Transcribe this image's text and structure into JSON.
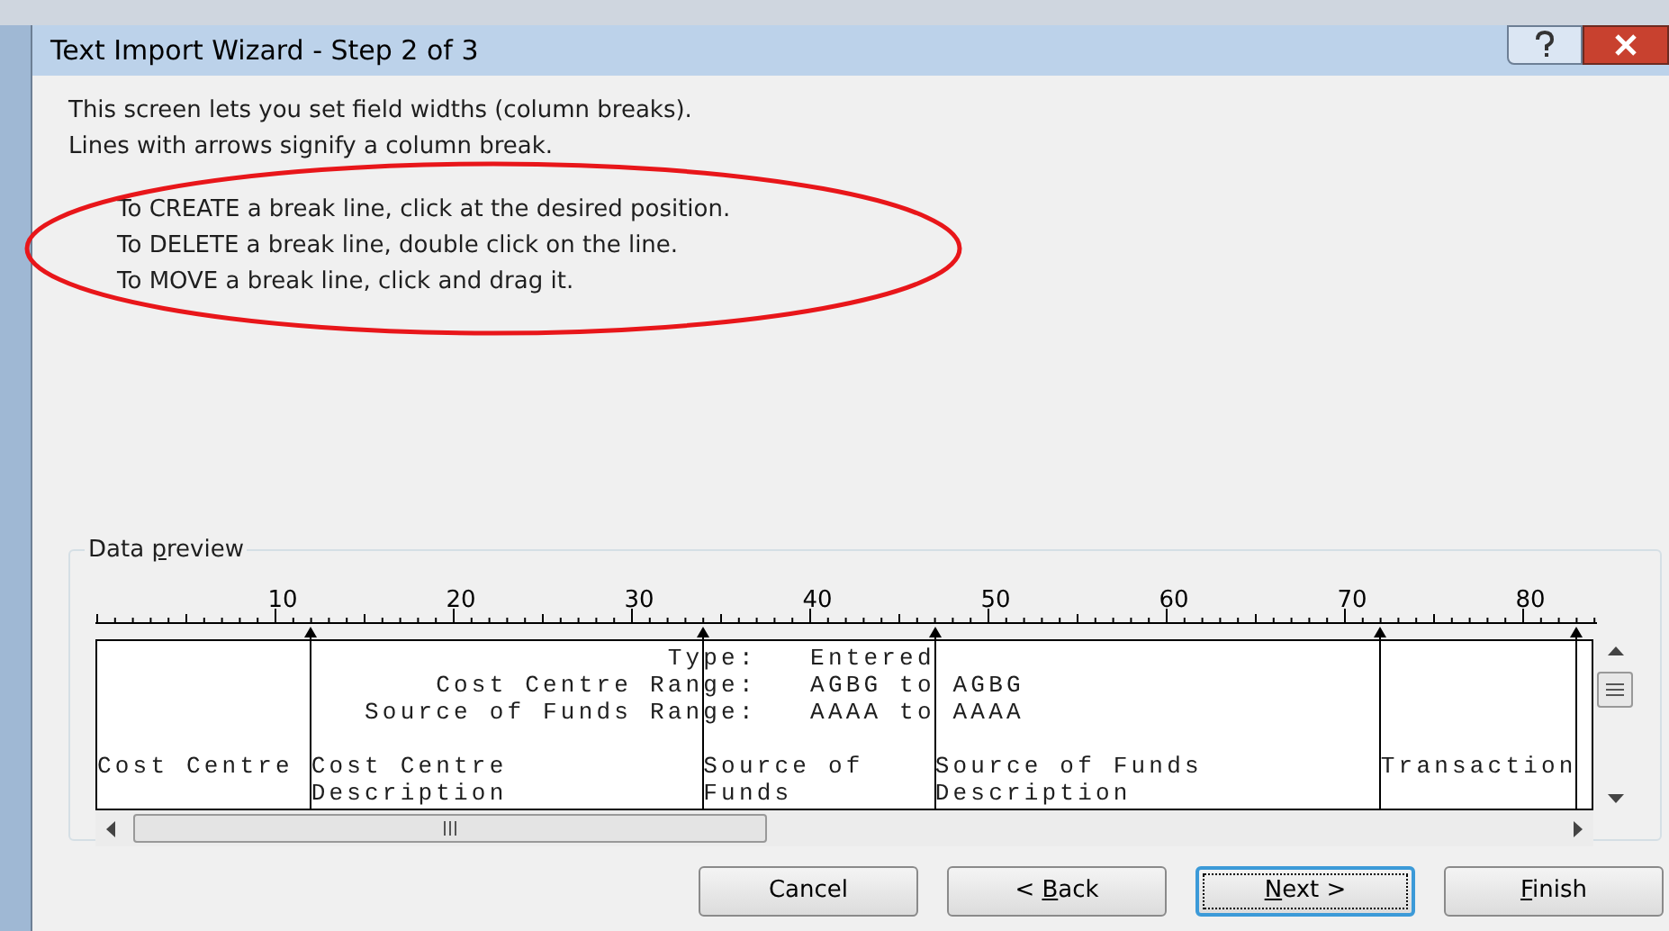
{
  "window": {
    "title": "Text Import Wizard - Step 2 of 3"
  },
  "intro": [
    "This screen lets you set field widths (column breaks).",
    "Lines with arrows signify a column break."
  ],
  "instructions": [
    "To CREATE a break line, click at the desired position.",
    "To DELETE a break line, double click on the line.",
    "To MOVE a break line, click and drag it."
  ],
  "data_preview": {
    "label": {
      "before": "Data ",
      "key": "p",
      "after": "review"
    },
    "ruler_labels": [
      "10",
      "20",
      "30",
      "40",
      "50",
      "60",
      "70",
      "80"
    ],
    "breaks": [
      {
        "level": 0.1429
      },
      {
        "level": 0.4048
      },
      {
        "level": 0.5595
      },
      {
        "level": 0.8571
      },
      {
        "level": 0.9881
      }
    ],
    "header_lines": [
      "                                Type:   Entered",
      "                   Cost Centre Range:   AGBG to AGBG",
      "               Source of Funds Range:   AAAA to AAAA"
    ],
    "column_lines": [
      "Cost Centre Cost Centre           Source of    Source of Funds          Transaction",
      "            Description           Funds        Description"
    ]
  },
  "buttons": [
    {
      "before": "Cancel",
      "default": false
    },
    {
      "before": "< ",
      "key": "B",
      "after": "ack",
      "default": false
    },
    {
      "key": "N",
      "after": "ext >",
      "default": true
    },
    {
      "key": "F",
      "after": "inish",
      "default": false
    }
  ]
}
